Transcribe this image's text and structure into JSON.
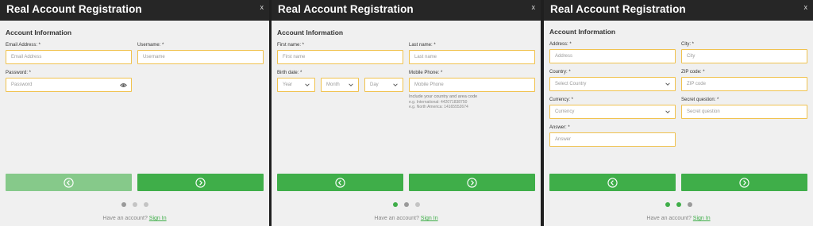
{
  "common": {
    "title": "Real Account Registration",
    "close": "x",
    "section": "Account Information",
    "have_account": "Have an account?",
    "sign_in": "Sign In",
    "accent": "#3fae49",
    "border": "#f0c24e"
  },
  "step1": {
    "email_label": "Email Address: *",
    "email_placeholder": "Email Address",
    "username_label": "Username: *",
    "username_placeholder": "Username",
    "password_label": "Password: *",
    "password_placeholder": "Password"
  },
  "step2": {
    "first_label": "First name: *",
    "first_placeholder": "First name",
    "last_label": "Last name: *",
    "last_placeholder": "Last name",
    "birth_label": "Birth date: *",
    "year": "Year",
    "month": "Month",
    "day": "Day",
    "phone_label": "Mobile Phone: *",
    "phone_placeholder": "Mobile Phone",
    "hint1": "Include your country and area code",
    "hint2": "e.g. International: 442071838750",
    "hint3": "e.g. North America: 14165552674"
  },
  "step3": {
    "address_label": "Address: *",
    "address_placeholder": "Address",
    "city_label": "City: *",
    "city_placeholder": "City",
    "country_label": "Country: *",
    "country_value": "Select Country",
    "zip_label": "ZIP code: *",
    "zip_placeholder": "ZIP code",
    "currency_label": "Currency: *",
    "currency_value": "Currency",
    "secret_label": "Secret question: *",
    "secret_placeholder": "Secret question",
    "answer_label": "Answer: *",
    "answer_placeholder": "Answer"
  }
}
